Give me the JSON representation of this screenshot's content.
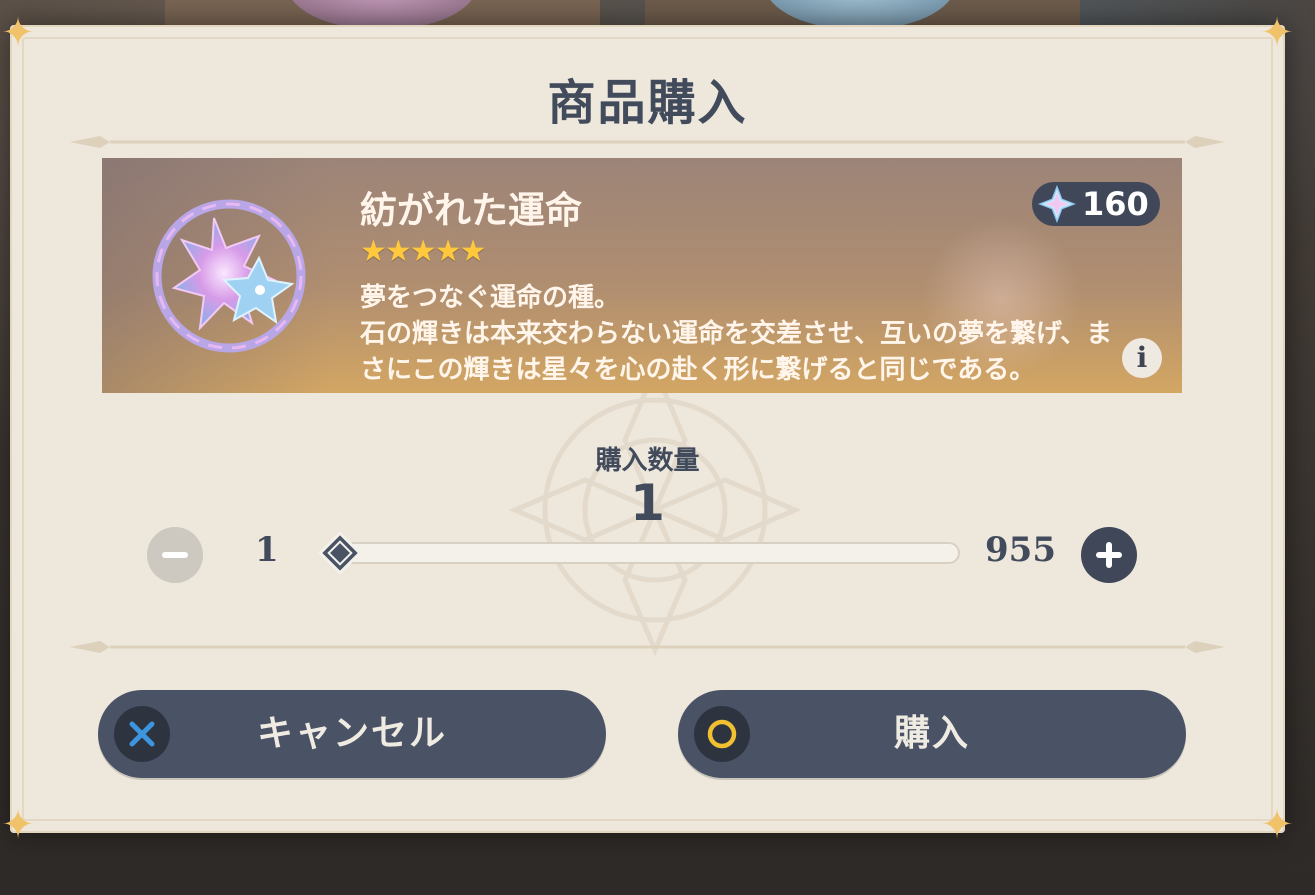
{
  "dialog": {
    "title": "商品購入",
    "cancel_label": "キャンセル",
    "confirm_label": "購入"
  },
  "item": {
    "name": "紡がれた運命",
    "stars": "★★★★★",
    "rarity": 5,
    "price": "160",
    "description": "夢をつなぐ運命の種。\n石の輝きは本来交わらない運命を交差させ、互いの夢を繋げ、まさにこの輝きは星々を心の赴く形に繋げると同じである。"
  },
  "quantity": {
    "label": "購入数量",
    "value": "1",
    "min": "1",
    "max": "955",
    "level_fraction": 0
  },
  "icons": {
    "minus": "minus-icon",
    "plus": "plus-icon",
    "cancel": "cross-icon",
    "confirm": "circle-icon",
    "currency": "primogem-icon",
    "info": "info-icon"
  },
  "colors": {
    "title_text": "#424b5c",
    "button_bg": "#4a5265",
    "star": "#ffc83d",
    "cross_icon": "#3d95e0",
    "circle_icon": "#f0c030",
    "dialog_bg": "#ede7dc"
  }
}
